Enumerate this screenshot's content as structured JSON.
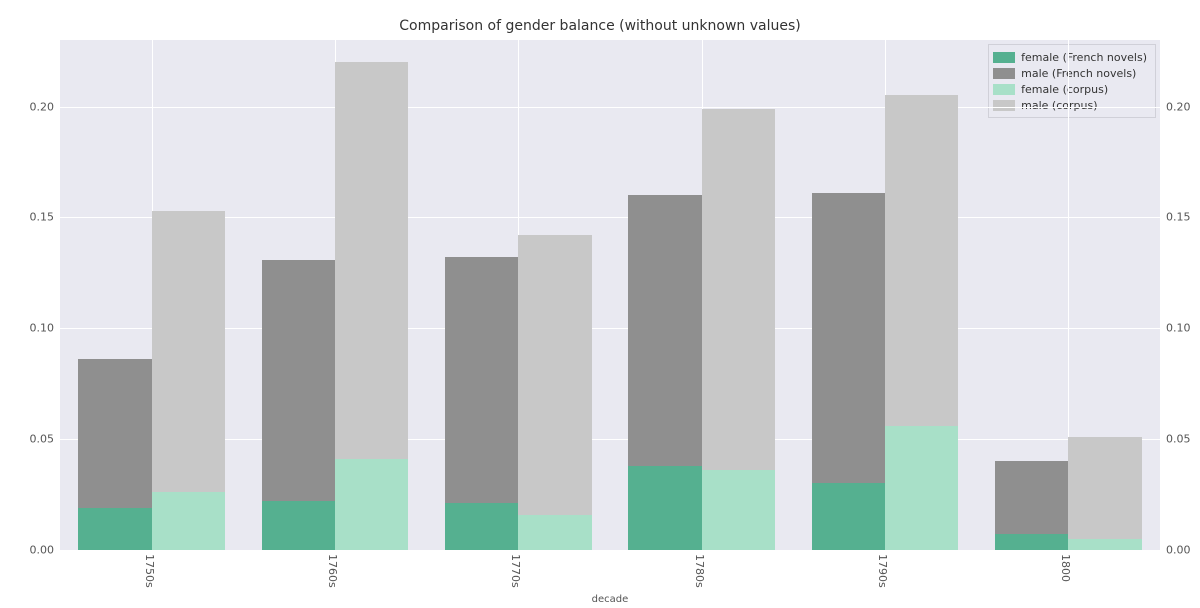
{
  "chart_data": {
    "type": "bar",
    "title": "Comparison of gender balance (without unknown values)",
    "xlabel": "decade",
    "ylabel": "",
    "ylim": [
      0.0,
      0.23
    ],
    "yticks": [
      0.0,
      0.05,
      0.1,
      0.15,
      0.2
    ],
    "ytick_labels": [
      "0.00",
      "0.05",
      "0.10",
      "0.15",
      "0.20"
    ],
    "categories": [
      "1750s",
      "1760s",
      "1770s",
      "1780s",
      "1790s",
      "1800"
    ],
    "series": [
      {
        "name": "female (French novels)",
        "color": "#55b090",
        "values": [
          0.019,
          0.022,
          0.021,
          0.038,
          0.03,
          0.007
        ]
      },
      {
        "name": "male (French novels)",
        "color": "#8f8f8f",
        "values": [
          0.086,
          0.131,
          0.132,
          0.16,
          0.161,
          0.04
        ]
      },
      {
        "name": "female (corpus)",
        "color": "#a8e0c8",
        "values": [
          0.026,
          0.041,
          0.016,
          0.036,
          0.056,
          0.005
        ]
      },
      {
        "name": "male (corpus)",
        "color": "#c8c8c8",
        "values": [
          0.153,
          0.22,
          0.142,
          0.199,
          0.205,
          0.051
        ]
      }
    ],
    "legend_pos": "upper-right"
  }
}
